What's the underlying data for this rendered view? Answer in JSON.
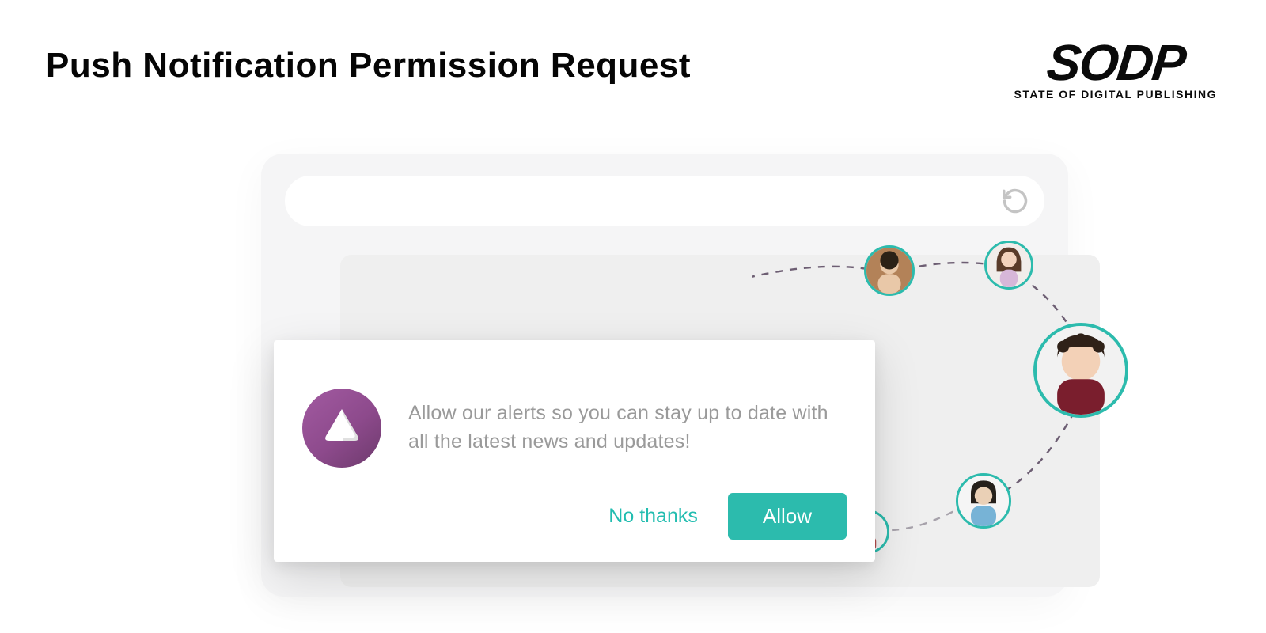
{
  "page": {
    "title": "Push Notification Permission Request"
  },
  "brand": {
    "name": "SODP",
    "tagline": "STATE OF DIGITAL PUBLISHING"
  },
  "popup": {
    "message": "Allow our alerts so you can stay up to date with all the latest news and updates!",
    "accept_label": "Allow",
    "decline_label": "No thanks"
  },
  "colors": {
    "accent": "#2cbbad",
    "icon_purple": "#8d4a8c"
  }
}
